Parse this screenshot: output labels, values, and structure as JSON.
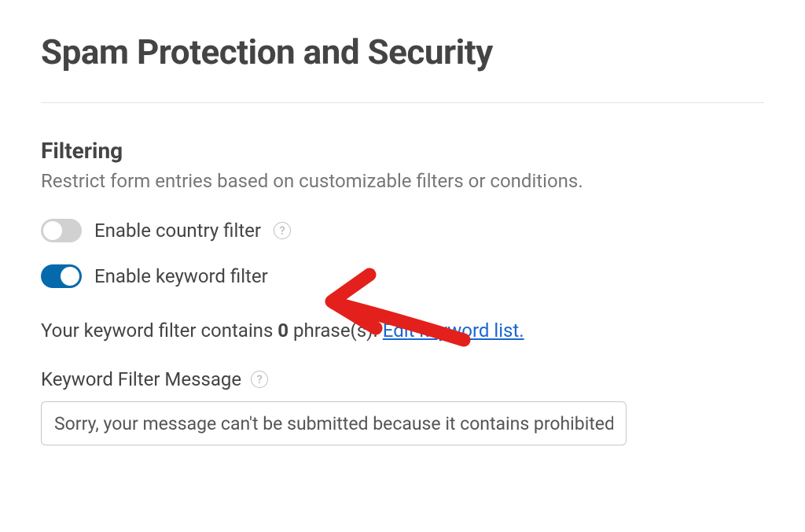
{
  "page": {
    "title": "Spam Protection and Security"
  },
  "filtering": {
    "section_title": "Filtering",
    "section_desc": "Restrict form entries based on customizable filters or conditions.",
    "country_filter_label": "Enable country filter",
    "keyword_filter_label": "Enable keyword filter",
    "help_symbol": "?",
    "info_prefix": "Your keyword filter contains ",
    "count": "0",
    "info_suffix": " phrase(s). ",
    "edit_link": "Edit keyword list.",
    "field_label": "Keyword Filter Message",
    "message_value": "Sorry, your message can't be submitted because it contains prohibited words."
  }
}
